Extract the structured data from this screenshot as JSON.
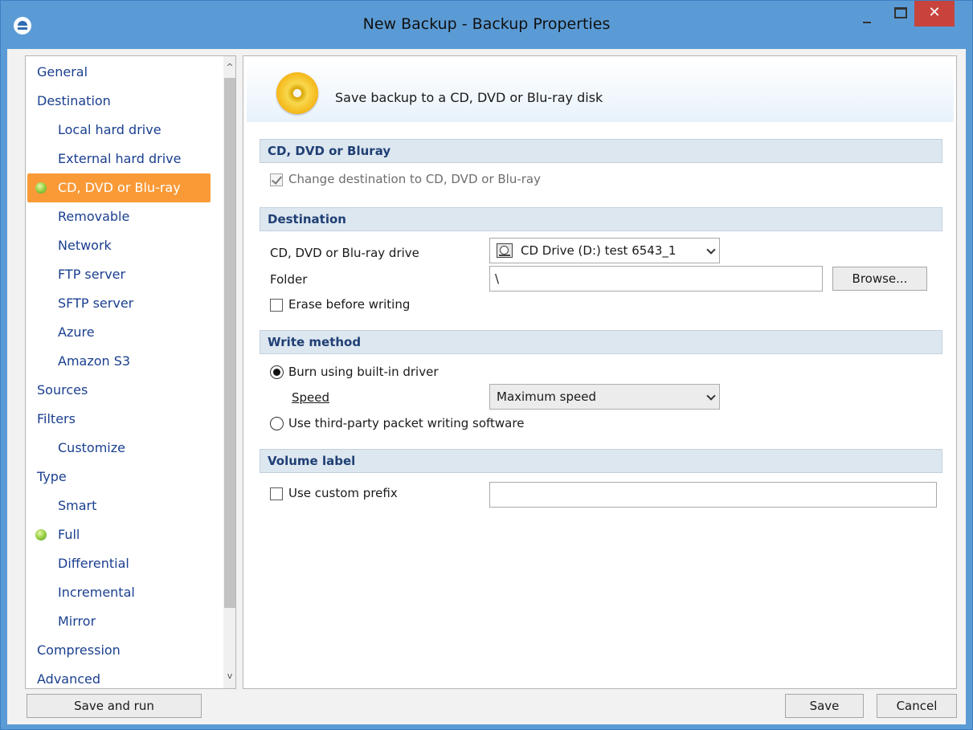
{
  "window": {
    "title": "New Backup - Backup Properties",
    "close_glyph": "✕"
  },
  "sidebar": {
    "items": [
      {
        "label": "General",
        "level": 1
      },
      {
        "label": "Destination",
        "level": 1
      },
      {
        "label": "Local hard drive",
        "level": 2
      },
      {
        "label": "External hard drive",
        "level": 2
      },
      {
        "label": "CD, DVD or Blu-ray",
        "level": 2,
        "selected": true,
        "bullet": true
      },
      {
        "label": "Removable",
        "level": 2
      },
      {
        "label": "Network",
        "level": 2
      },
      {
        "label": "FTP server",
        "level": 2
      },
      {
        "label": "SFTP server",
        "level": 2
      },
      {
        "label": "Azure",
        "level": 2
      },
      {
        "label": "Amazon S3",
        "level": 2
      },
      {
        "label": "Sources",
        "level": 1
      },
      {
        "label": "Filters",
        "level": 1
      },
      {
        "label": "Customize",
        "level": 2
      },
      {
        "label": "Type",
        "level": 1
      },
      {
        "label": "Smart",
        "level": 2
      },
      {
        "label": "Full",
        "level": 2,
        "bullet": true
      },
      {
        "label": "Differential",
        "level": 2
      },
      {
        "label": "Incremental",
        "level": 2
      },
      {
        "label": "Mirror",
        "level": 2
      },
      {
        "label": "Compression",
        "level": 1
      },
      {
        "label": "Advanced",
        "level": 1
      }
    ],
    "scroll_up": "^",
    "scroll_down": "v"
  },
  "header": {
    "text": "Save backup to a CD, DVD or Blu-ray disk"
  },
  "sections": {
    "cd": {
      "title": "CD, DVD or Bluray",
      "change_dest_label": "Change destination to CD, DVD or Blu-ray"
    },
    "destination": {
      "title": "Destination",
      "drive_label": "CD, DVD or Blu-ray drive",
      "drive_value": "CD Drive (D:) test 6543_1",
      "folder_label": "Folder",
      "folder_value": "\\",
      "browse_label": "Browse...",
      "erase_label": "Erase before writing"
    },
    "write": {
      "title": "Write method",
      "burn_label": "Burn using built-in driver",
      "speed_label": "Speed",
      "speed_value": "Maximum speed",
      "third_party_label": "Use third-party packet writing software"
    },
    "volume": {
      "title": "Volume label",
      "prefix_label": "Use custom prefix",
      "prefix_value": ""
    }
  },
  "footer": {
    "save_and_run": "Save and run",
    "save": "Save",
    "cancel": "Cancel"
  },
  "colors": {
    "title_bar": "#5b9bd5",
    "close_button": "#c7433c",
    "selected_item": "#f99a37",
    "nav_text": "#1a3f8f",
    "section_bar": "#dde7f0"
  }
}
